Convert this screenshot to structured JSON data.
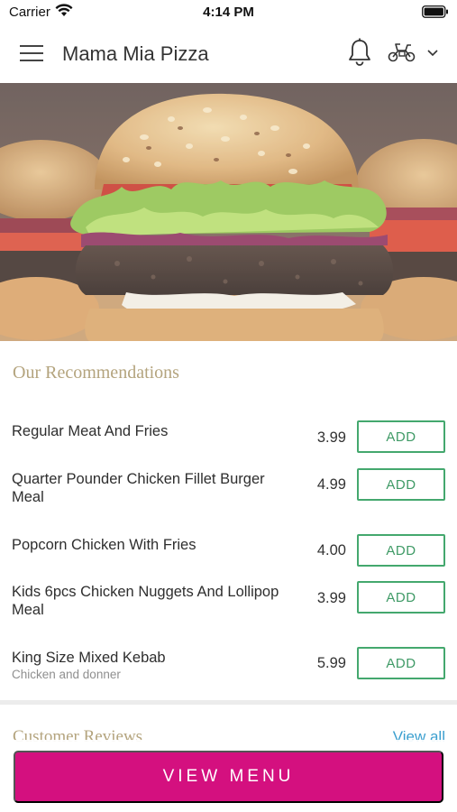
{
  "status_bar": {
    "carrier": "Carrier",
    "time": "4:14 PM"
  },
  "header": {
    "title": "Mama Mia Pizza",
    "menu_icon": "hamburger-icon",
    "notification_icon": "bell-icon",
    "delivery_icon": "scooter-icon"
  },
  "hero": {
    "image": "burger-photo"
  },
  "recommendations": {
    "title": "Our Recommendations",
    "add_label": "ADD",
    "items": [
      {
        "name": "Regular Meat And Fries",
        "price": "3.99"
      },
      {
        "name": "Quarter Pounder Chicken Fillet Burger Meal",
        "price": "4.99"
      },
      {
        "name": "Popcorn Chicken With Fries",
        "price": "4.00"
      },
      {
        "name": "Kids 6pcs Chicken Nuggets And Lollipop Meal",
        "price": "3.99"
      },
      {
        "name": "King Size Mixed Kebab",
        "subtitle": "Chicken and donner",
        "price": "5.99"
      }
    ]
  },
  "reviews": {
    "title": "Customer Reviews",
    "view_all": "View all"
  },
  "footer": {
    "view_menu": "VIEW MENU"
  },
  "colors": {
    "accent": "#d4107f",
    "add_border": "#44a86e",
    "section_title": "#b4a47e",
    "link": "#3b9fcf"
  }
}
